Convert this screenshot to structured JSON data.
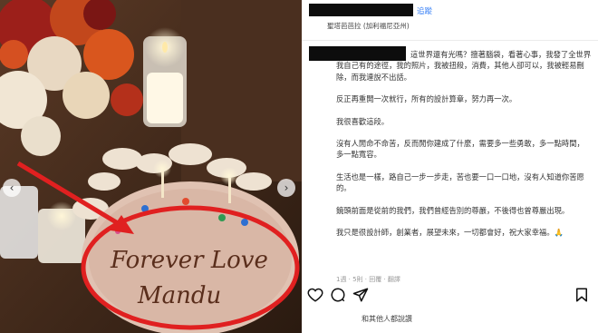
{
  "post": {
    "follow_label": "追蹤",
    "location": "聖塔芭芭拉 (加利福尼亞州)",
    "caption": [
      "這世界還有光嗎？擅著腦袋，看著心事，我發了全世界我自己有的途徑，我的照片，我被扭殺，消費，其他人卻可以，我被輕易刪除，而我連說不出話。",
      "反正再重開一次就行，所有的設計算章，努力再一次。",
      "我很喜歡這段。",
      "沒有人閒命不命苦，反而閒你建成了什麼，需要多一些勇敢，多一點時間，多一點寬容。",
      "生活也是一樣，路自己一步一步走，苦也要一口一口地，沒有人知道你苦愿的。",
      "鏡頭前面是從前的我們，我們曾經告別的尊嚴，不後得也曾尊嚴出現。",
      "我只是很設計師，創業者，展望未來，一切都會好，祝大家幸福。🙏"
    ],
    "meta": "1週 · 5則 · 回覆 · 翻譯",
    "likes": "和其他人都說讚",
    "cake_text": [
      "Forever Love",
      "Mandu"
    ]
  },
  "icons": {
    "like": "heart-icon",
    "comment": "comment-icon",
    "share": "share-icon",
    "save": "bookmark-icon",
    "prev": "chevron-left-icon",
    "next": "chevron-right-icon"
  },
  "colors": {
    "annotation_red": "#e02020",
    "link_blue": "#3b82f6"
  }
}
